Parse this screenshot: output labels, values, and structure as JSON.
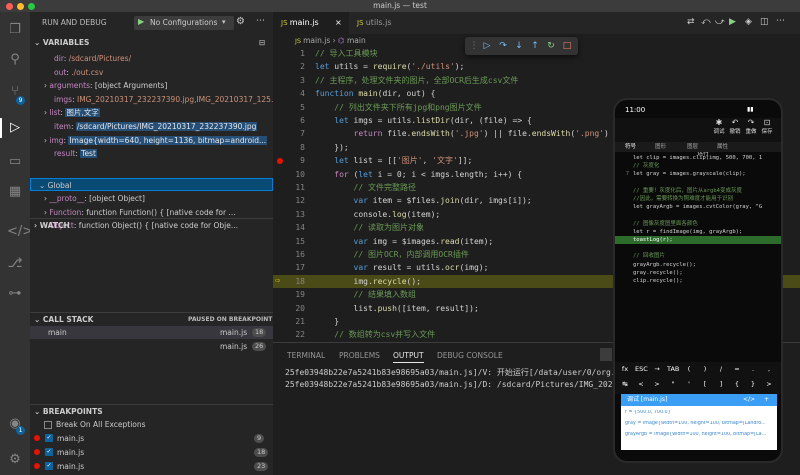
{
  "window": {
    "title": "main.js — test"
  },
  "activity_badges": {
    "scm": "9",
    "account": "1"
  },
  "debug": {
    "header": "RUN AND DEBUG",
    "config": "No Configurations"
  },
  "sections": {
    "variables": "VARIABLES",
    "watch": "WATCH",
    "call_stack": "CALL STACK",
    "paused": "PAUSED ON BREAKPOINT",
    "breakpoints": "BREAKPOINTS"
  },
  "variables": [
    {
      "key": "dir",
      "value": "/sdcard/Pictures/"
    },
    {
      "key": "out",
      "value": "./out.csv"
    },
    {
      "key": "arguments",
      "value": "[object Arguments]"
    },
    {
      "key": "imgs",
      "value": "IMG_20210317_232237390.jpg,IMG_20210317_125..."
    },
    {
      "key": "list",
      "value": "图片,文字"
    },
    {
      "key": "item",
      "value": "/sdcard/Pictures/IMG_20210317_232237390.jpg"
    },
    {
      "key": "img",
      "value": "Image{width=640, height=1136, bitmap=android..."
    },
    {
      "key": "result",
      "value": "Test"
    }
  ],
  "global": {
    "label": "Global",
    "items": [
      {
        "key": "__proto__",
        "value": "[object Object]"
      },
      {
        "key": "Function",
        "value": "function Function() { [native code for ..."
      },
      {
        "key": "Object",
        "value": "function Object() { [native code for Obje..."
      }
    ]
  },
  "call_stack": [
    {
      "name": "main",
      "file": "main.js",
      "line": "18"
    },
    {
      "name": "",
      "file": "main.js",
      "line": "26"
    }
  ],
  "breakpoints": {
    "break_all": "Break On All Exceptions",
    "items": [
      {
        "file": "main.js",
        "line": "9"
      },
      {
        "file": "main.js",
        "line": "18"
      },
      {
        "file": "main.js",
        "line": "23"
      }
    ]
  },
  "tabs": [
    {
      "label": "main.js",
      "active": true
    },
    {
      "label": "utils.js",
      "active": false
    }
  ],
  "breadcrumb": {
    "file": "main.js",
    "symbol": "main"
  },
  "code_lines": [
    {
      "n": "1",
      "text": "// 导入工具模块"
    },
    {
      "n": "2",
      "text": "let utils = require('./utils');"
    },
    {
      "n": "3",
      "text": "// 主程序，处理文件夹的图片，全部OCR后生成csv文件"
    },
    {
      "n": "4",
      "text": "function main(dir, out) {"
    },
    {
      "n": "5",
      "text": "    // 列出文件夹下所有jpg和png图片文件"
    },
    {
      "n": "6",
      "text": "    let imgs = utils.listDir(dir, (file) => {"
    },
    {
      "n": "7",
      "text": "        return file.endsWith('.jpg') || file.endsWith('.png')"
    },
    {
      "n": "8",
      "text": "    });"
    },
    {
      "n": "9",
      "text": "    let list = [['图片', '文字']];"
    },
    {
      "n": "10",
      "text": "    for (let i = 0; i < imgs.length; i++) {"
    },
    {
      "n": "11",
      "text": "        // 文件完整路径"
    },
    {
      "n": "12",
      "text": "        var item = $files.join(dir, imgs[i]);"
    },
    {
      "n": "13",
      "text": "        console.log(item);"
    },
    {
      "n": "14",
      "text": "        // 读取为图片对象"
    },
    {
      "n": "15",
      "text": "        var img = $images.read(item);"
    },
    {
      "n": "16",
      "text": "        // 图片OCR，内部调用OCR插件"
    },
    {
      "n": "17",
      "text": "        var result = utils.ocr(img);"
    },
    {
      "n": "18",
      "text": "        img.recycle();"
    },
    {
      "n": "19",
      "text": "        // 结果填入数组"
    },
    {
      "n": "20",
      "text": "        list.push([item, result]);"
    },
    {
      "n": "21",
      "text": "    }"
    },
    {
      "n": "22",
      "text": "    // 数组转为csv并写入文件"
    },
    {
      "n": "23",
      "text": "    $files.write(out, util.toCsv(list));"
    },
    {
      "n": "24",
      "text": "}"
    },
    {
      "n": "25",
      "text": "// 调用主程序"
    }
  ],
  "panel": {
    "tabs": [
      "TERMINAL",
      "PROBLEMS",
      "OUTPUT",
      "DEBUG CONSOLE"
    ],
    "active_tab": "OUTPUT",
    "output_lines": [
      "25fe03948b22e7a5241b83e98695a03/main.js]/V: 开始运行[/data/user/0/org.a",
      "25fe03948b22e7a5241b83e98695a03/main.js]/D: /sdcard/Pictures/IMG_2021"
    ]
  },
  "phone": {
    "time": "11:00",
    "toolbar": [
      "运行",
      "调试",
      "撤销",
      "重做",
      "保存",
      "..."
    ],
    "subtabs": [
      "符号",
      "图形",
      "图层",
      "属性"
    ],
    "code": [
      {
        "n": "",
        "text": "let clip = images.clip(img, 500, 700, 1"
      },
      {
        "n": "",
        "text": "// 灰度化"
      },
      {
        "n": "7",
        "text": "let gray = images.grayscale(clip);"
      },
      {
        "n": "",
        "text": ""
      },
      {
        "n": "",
        "text": "// 重要！灰度化后，图片从argb4变成灰度"
      },
      {
        "n": "",
        "text": "//因此，需要转换为照难度才能用于识别"
      },
      {
        "n": "",
        "text": "let grayArgb = images.cvtColor(gray, \"G"
      },
      {
        "n": "",
        "text": ""
      },
      {
        "n": "",
        "text": "// 图像灰度图里面各颜色"
      },
      {
        "n": "",
        "text": "let r = findImage(img, grayArgb);"
      },
      {
        "n": "",
        "text": "toastLog(r);"
      },
      {
        "n": "",
        "text": ""
      },
      {
        "n": "",
        "text": "// 回收图片"
      },
      {
        "n": "",
        "text": "grayArgb.recycle();"
      },
      {
        "n": "",
        "text": "gray.recycle();"
      },
      {
        "n": "",
        "text": "clip.recycle();"
      }
    ],
    "keys_row1": [
      "fx",
      "ESC",
      "→",
      "TAB",
      "(",
      ")",
      "/",
      "=",
      ".",
      ","
    ],
    "keys_row2": [
      "↹",
      "<",
      ">",
      "\"",
      "'",
      "[",
      "]",
      "{",
      "}",
      ">"
    ],
    "console_title": "调试 [main.js]",
    "console_lines": [
      "r = {500.0, 700.0}",
      "gray = Image{width=100, height=100, bitmap=[Landro...",
      "grayArgb = Image{width=100, height=100, bitmap=[La..."
    ]
  },
  "colors": {
    "accent": "#0e639c",
    "keyword": "#569cd6",
    "control": "#c586c0",
    "string": "#ce9178",
    "comment": "#6a9955",
    "func": "#dcdcaa",
    "var": "#9cdcfe",
    "current_line": "#4b4b18",
    "breakpoint": "#e51400"
  }
}
